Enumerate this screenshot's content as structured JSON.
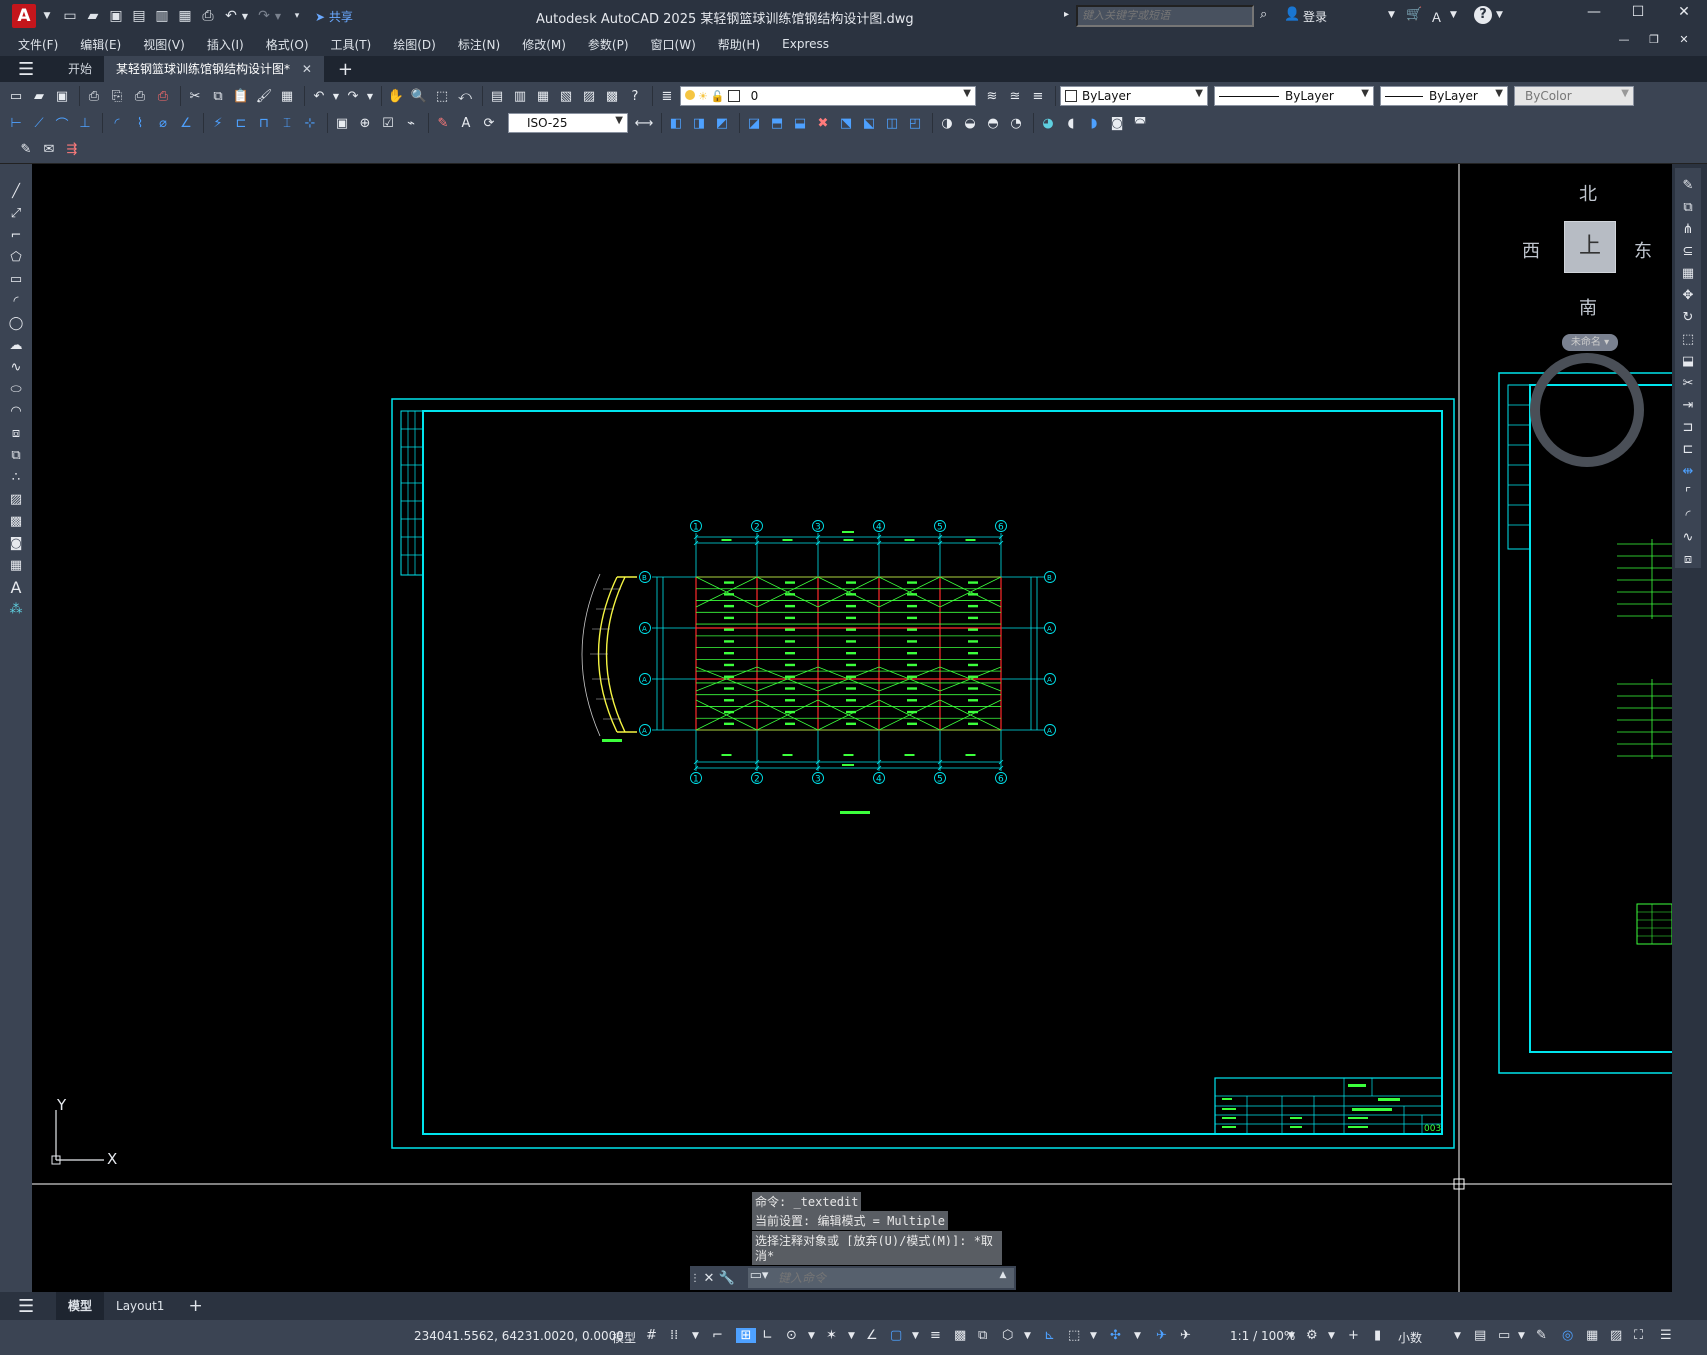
{
  "app": {
    "logo_letter": "A",
    "title": "Autodesk AutoCAD 2025    某轻钢篮球训练馆钢结构设计图.dwg",
    "search_placeholder": "键入关键字或短语",
    "signin_label": "登录",
    "share_label": "共享",
    "help_label": "?"
  },
  "menu": [
    "文件(F)",
    "编辑(E)",
    "视图(V)",
    "插入(I)",
    "格式(O)",
    "工具(T)",
    "绘图(D)",
    "标注(N)",
    "修改(M)",
    "参数(P)",
    "窗口(W)",
    "帮助(H)",
    "Express"
  ],
  "tabs": {
    "start": "开始",
    "drawing": "某轻钢篮球训练馆钢结构设计图*"
  },
  "toolbar": {
    "layer_value": "0",
    "color_value": "ByLayer",
    "linetype_value": "ByLayer",
    "lineweight_value": "ByLayer",
    "plotstyle_value": "ByColor",
    "dimstyle_value": "ISO-25"
  },
  "viewcube": {
    "north": "北",
    "south": "南",
    "east": "东",
    "west": "西",
    "top": "上",
    "wcs": "未命名"
  },
  "drawing": {
    "grid_numbers": [
      "1",
      "2",
      "3",
      "4",
      "5",
      "6"
    ],
    "grid_letters": [
      "B",
      "1/A",
      "1/A",
      "A"
    ],
    "sheet_number": "003"
  },
  "ucs": {
    "x": "X",
    "y": "Y"
  },
  "command": {
    "history": [
      "命令: _textedit",
      "当前设置: 编辑模式 = Multiple",
      "选择注释对象或 [放弃(U)/模式(M)]: *取",
      "消*"
    ],
    "placeholder": "键入命令"
  },
  "layout_tabs": [
    "模型",
    "Layout1"
  ],
  "status": {
    "coordinates": "234041.5562, 64231.0020, 0.0000",
    "space": "模型",
    "scale": "1:1 / 100%",
    "units": "小数"
  }
}
